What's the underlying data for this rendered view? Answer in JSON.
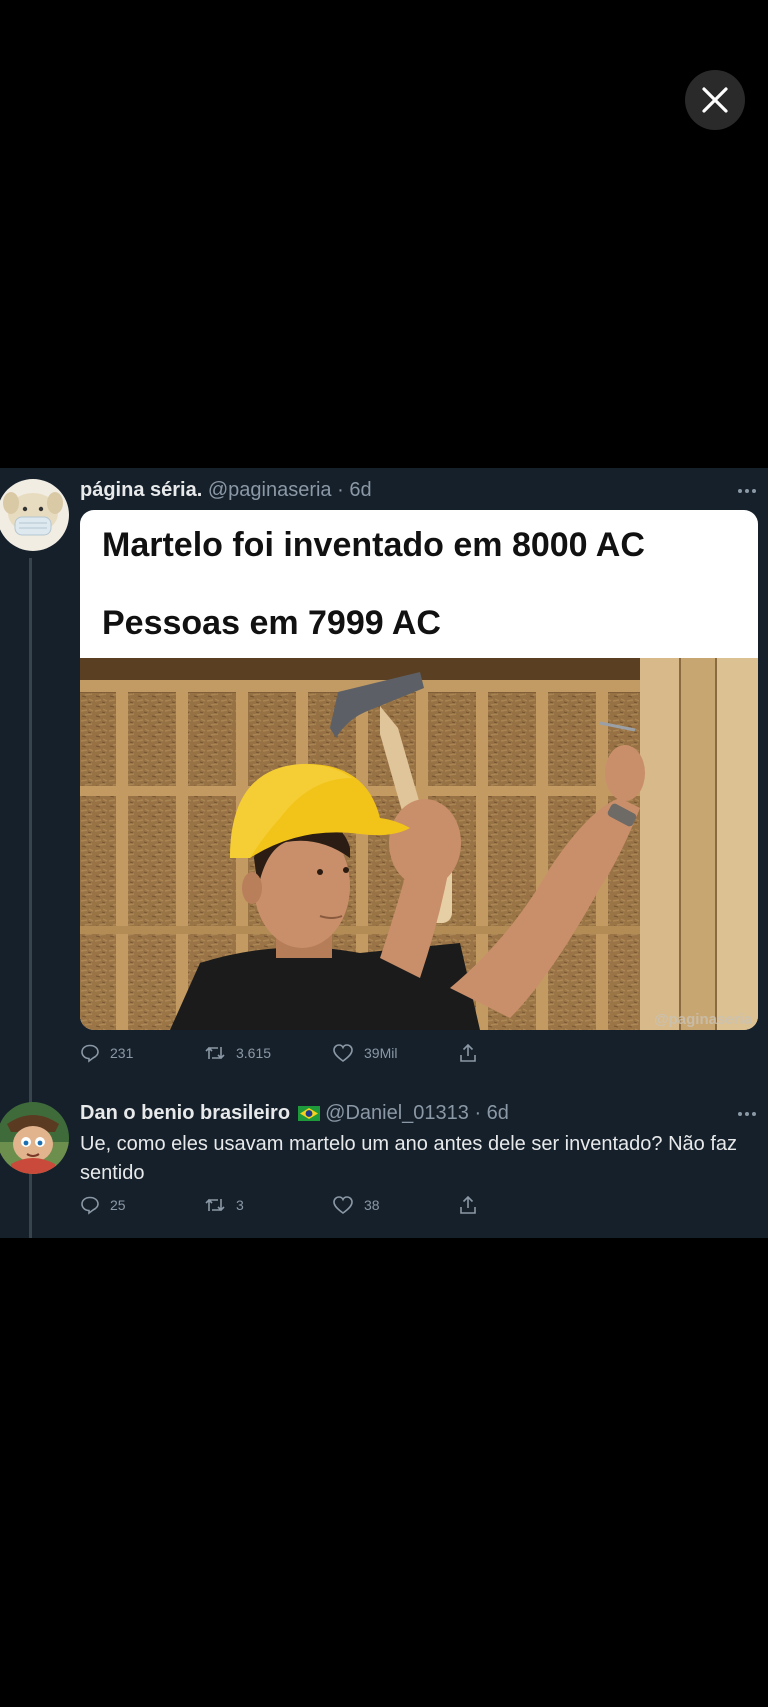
{
  "viewer": {
    "close_icon": "close-icon"
  },
  "tweet": {
    "author_name": "página séria.",
    "handle_time": "@paginaseria · 6d",
    "meme": {
      "line1": "Martelo foi inventado em 8000 AC",
      "line2": "Pessoas em 7999 AC",
      "watermark": "@paginaseria"
    },
    "stats": {
      "replies": "231",
      "retweets": "3.615",
      "likes": "39Mil"
    }
  },
  "reply": {
    "author_name": "Dan o benio brasileiro",
    "flag_icon": "brazil-flag-icon",
    "handle_time": "@Daniel_01313 · 6d",
    "text": "Ue, como eles usavam martelo um ano antes dele ser inventado? Não faz sentido",
    "stats": {
      "replies": "25",
      "retweets": "3",
      "likes": "38"
    }
  }
}
